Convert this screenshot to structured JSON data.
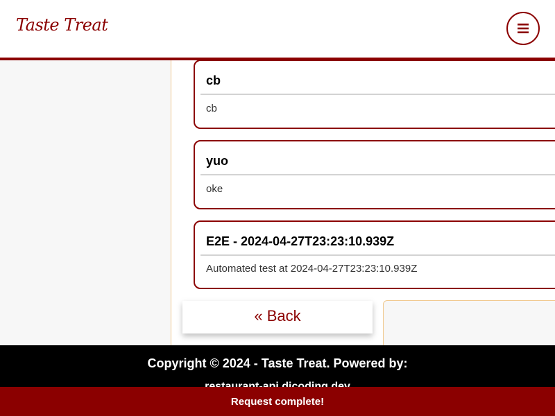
{
  "header": {
    "logo_text": "Taste Treat",
    "menu_icon": "hamburger-menu-icon",
    "brand_color": "#8b0000"
  },
  "reviews": [
    {
      "title": "cb",
      "body": "cb"
    },
    {
      "title": "yuo",
      "body": "oke"
    },
    {
      "title": "E2E - 2024-04-27T23:23:10.939Z",
      "body": "Automated test at 2024-04-27T23:23:10.939Z"
    }
  ],
  "back_label": "« Back",
  "footer": {
    "copyright": "Copyright © 2024 - Taste Treat. Powered by:",
    "powered_link": "restaurant-api.dicoding.dev"
  },
  "toast": {
    "message": "Request complete!"
  }
}
